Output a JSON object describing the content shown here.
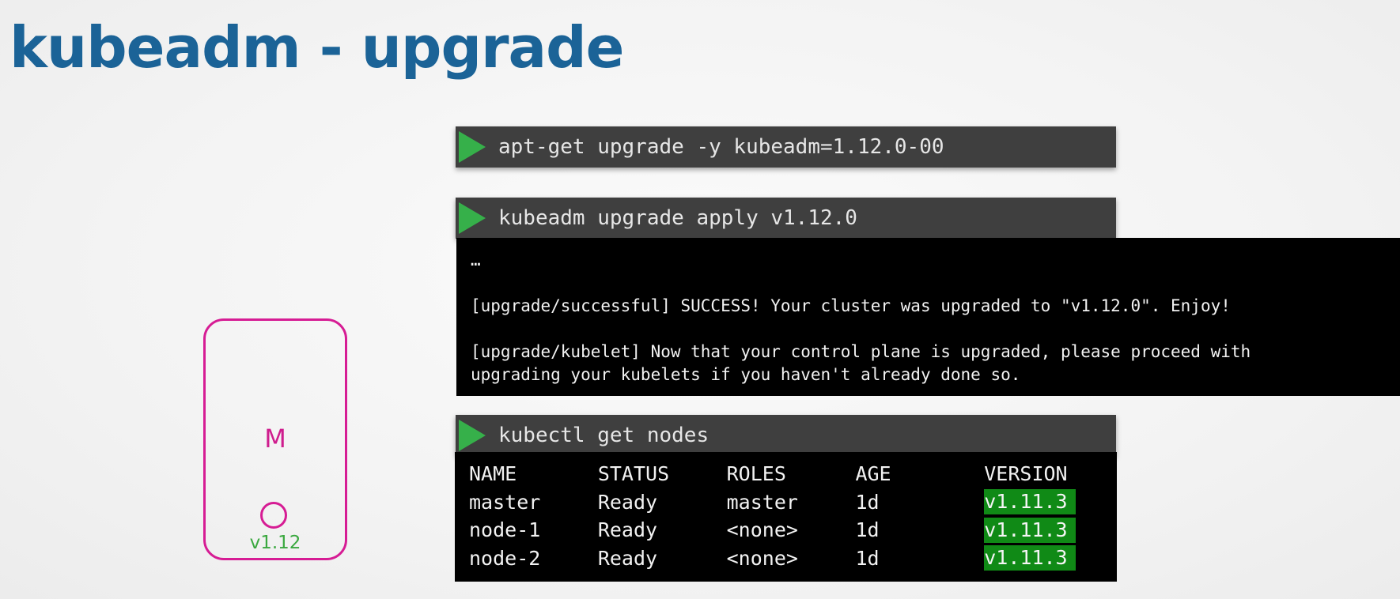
{
  "title": "kubeadm - upgrade",
  "commands": [
    {
      "text": "apt-get upgrade -y kubeadm=1.12.0-00",
      "icon": "play-icon"
    },
    {
      "text": "kubeadm upgrade apply v1.12.0",
      "icon": "play-icon"
    },
    {
      "text": "kubectl get nodes",
      "icon": "play-icon"
    }
  ],
  "apply_output": {
    "ellipsis": "…",
    "success_line": "[upgrade/successful] SUCCESS! Your cluster was upgraded to \"v1.12.0\". Enjoy!",
    "kubelet_line_1": "[upgrade/kubelet] Now that your control plane is upgraded, please proceed with",
    "kubelet_line_2": "upgrading your kubelets if you haven't already done so."
  },
  "nodes_table": {
    "headers": [
      "NAME",
      "STATUS",
      "ROLES",
      "AGE",
      "VERSION"
    ],
    "rows": [
      [
        "master",
        "Ready",
        "master",
        "1d",
        "v1.11.3"
      ],
      [
        "node-1",
        "Ready",
        "<none>",
        "1d",
        "v1.11.3"
      ],
      [
        "node-2",
        "Ready",
        "<none>",
        "1d",
        "v1.11.3"
      ]
    ]
  },
  "master_node": {
    "label": "M",
    "kubelet_version": "v1.12"
  },
  "colors": {
    "title": "#1b6397",
    "command_bar": "#3f3f3f",
    "play_icon": "#36b04a",
    "version_highlight": "#108a16",
    "master_box": "#d61c94",
    "kubelet_version": "#3aa83f"
  }
}
